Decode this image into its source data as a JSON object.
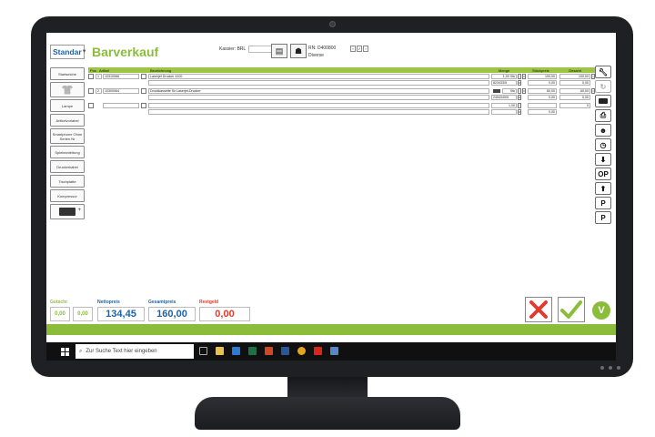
{
  "app": {
    "layout_select": "Standar",
    "title": "Barverkauf",
    "kassier_label": "Kassier: BRL",
    "receipt_no": "RN: D400800",
    "customer": "Diverse"
  },
  "sidebar": {
    "items": [
      "Startseiche",
      "",
      "Lampe",
      "Artikelvorlabel",
      "Smartphone Ohne Serien Nr",
      "Spieleanleitung",
      "Druckerkabel",
      "Tischplatte",
      "Kompressor",
      ""
    ]
  },
  "table": {
    "headers": [
      "Pos",
      "Artikel",
      "Bezeichnung",
      "Menge",
      "Stückpreis",
      "Gesamt"
    ],
    "rows": [
      {
        "pos": "1",
        "artikel": "10310066",
        "bezeichnung": "Laserjet Drucker 4100",
        "menge": "1,00",
        "einheit": "Stk",
        "stueckpreis": "100,00",
        "gesamt": "100,00",
        "sub1": "823433/5",
        "sub_price": "0,00",
        "sub_total": "0,00"
      },
      {
        "pos": "2",
        "artikel": "10300064",
        "bezeichnung": "Druckkassette für Laserjet-Drucker",
        "menge": "1,00",
        "einheit": "Stk",
        "stueckpreis": "60,00",
        "gesamt": "60,00",
        "sub1": "2454345/5",
        "sub_price": "0,00",
        "sub_total": "0,00"
      },
      {
        "pos": "",
        "artikel": "",
        "bezeichnung": "",
        "menge": "1,00",
        "einheit": "",
        "stueckpreis": "",
        "gesamt": "0",
        "sub1": "",
        "sub_price": "0,00",
        "sub_total": ""
      }
    ]
  },
  "totals": {
    "gutschrift_label": "Gutschr",
    "gutschrift_value1": "0,00",
    "gutschrift_value2": "0,00",
    "netto_label": "Nettopreis",
    "netto_value": "134,45",
    "gesamt_label": "Gesamtpreis",
    "gesamt_value": "160,00",
    "restgeld_label": "Restgeld",
    "restgeld_value": "0,00"
  },
  "right_tools": [
    "wrench-icon",
    "refresh-icon",
    "printer-icon",
    "print-preview-icon",
    "users-icon",
    "clock-icon",
    "arrow-down-icon",
    "OP",
    "arrow-up-icon",
    "P",
    "P"
  ],
  "taskbar": {
    "search_placeholder": "Zur Suche Text hier eingeben"
  },
  "colors": {
    "accent": "#8bbd3b",
    "blue": "#1d63a7",
    "red": "#e03b2e"
  }
}
